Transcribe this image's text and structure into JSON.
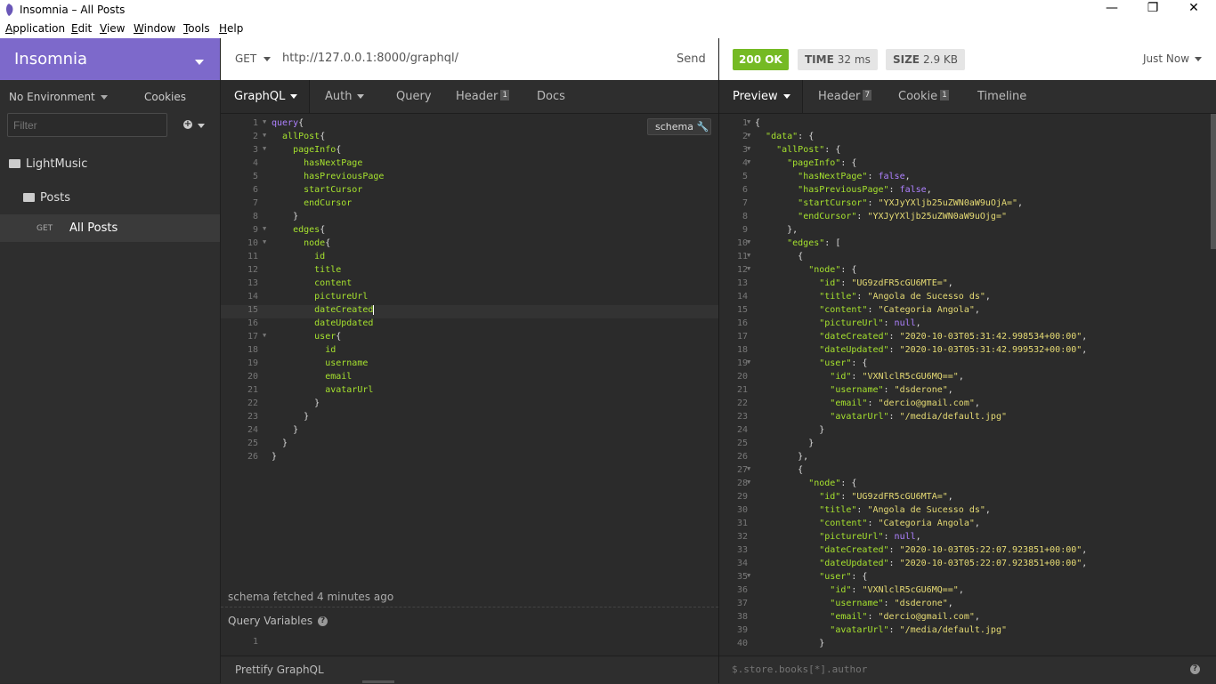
{
  "window": {
    "title": "Insomnia – All Posts",
    "controls": {
      "minimize": "—",
      "maximize": "❐",
      "close": "✕"
    }
  },
  "menu": [
    {
      "pre": "",
      "u": "A",
      "post": "pplication"
    },
    {
      "pre": "",
      "u": "E",
      "post": "dit"
    },
    {
      "pre": "",
      "u": "V",
      "post": "iew"
    },
    {
      "pre": "",
      "u": "W",
      "post": "indow"
    },
    {
      "pre": "",
      "u": "T",
      "post": "ools"
    },
    {
      "pre": "",
      "u": "H",
      "post": "elp"
    }
  ],
  "sidebar": {
    "brand": "Insomnia",
    "brand_color": "#7d69cb",
    "environment": "No Environment",
    "cookies": "Cookies",
    "filter_placeholder": "Filter",
    "workspace": "LightMusic",
    "folder": "Posts",
    "request": {
      "method": "GET",
      "name": "All Posts"
    }
  },
  "request": {
    "method": "GET",
    "url": "http://127.0.0.1:8000/graphql/",
    "send_label": "Send",
    "tabs": [
      {
        "label": "GraphQL",
        "badge": ""
      },
      {
        "label": "Auth",
        "badge": ""
      },
      {
        "label": "Query",
        "badge": ""
      },
      {
        "label": "Header",
        "badge": "1"
      },
      {
        "label": "Docs",
        "badge": ""
      }
    ],
    "schema_button": "schema",
    "schema_status": "schema fetched 4 minutes ago",
    "query_variables_label": "Query Variables",
    "query_variables_line": "1",
    "footer_label": "Prettify GraphQL",
    "query_lines": [
      "query{",
      "  allPost{",
      "    pageInfo{",
      "      hasNextPage",
      "      hasPreviousPage",
      "      startCursor",
      "      endCursor",
      "    }",
      "    edges{",
      "      node{",
      "        id",
      "        title",
      "        content",
      "        pictureUrl",
      "        dateCreated",
      "        dateUpdated",
      "        user{",
      "          id",
      "          username",
      "          email",
      "          avatarUrl",
      "        }",
      "      }",
      "    }",
      "  }",
      "}"
    ]
  },
  "response": {
    "status": "200 OK",
    "status_color": "#75ba24",
    "time_label": "TIME",
    "time_value": "32 ms",
    "size_label": "SIZE",
    "size_value": "2.9 KB",
    "timestamp": "Just Now",
    "tabs": [
      {
        "label": "Preview",
        "badge": ""
      },
      {
        "label": "Header",
        "badge": "7"
      },
      {
        "label": "Cookie",
        "badge": "1"
      },
      {
        "label": "Timeline",
        "badge": ""
      }
    ],
    "filter_placeholder": "$.store.books[*].author",
    "lines": [
      "{",
      "  \"data\": {",
      "    \"allPost\": {",
      "      \"pageInfo\": {",
      "        \"hasNextPage\": false,",
      "        \"hasPreviousPage\": false,",
      "        \"startCursor\": \"YXJyYXljb25uZWN0aW9uOjA=\",",
      "        \"endCursor\": \"YXJyYXljb25uZWN0aW9uOjg=\"",
      "      },",
      "      \"edges\": [",
      "        {",
      "          \"node\": {",
      "            \"id\": \"UG9zdFR5cGU6MTE=\",",
      "            \"title\": \"Angola de Sucesso ds\",",
      "            \"content\": \"Categoria Angola\",",
      "            \"pictureUrl\": null,",
      "            \"dateCreated\": \"2020-10-03T05:31:42.998534+00:00\",",
      "            \"dateUpdated\": \"2020-10-03T05:31:42.999532+00:00\",",
      "            \"user\": {",
      "              \"id\": \"VXNlclR5cGU6MQ==\",",
      "              \"username\": \"dsderone\",",
      "              \"email\": \"dercio@gmail.com\",",
      "              \"avatarUrl\": \"/media/default.jpg\"",
      "            }",
      "          }",
      "        },",
      "        {",
      "          \"node\": {",
      "            \"id\": \"UG9zdFR5cGU6MTA=\",",
      "            \"title\": \"Angola de Sucesso ds\",",
      "            \"content\": \"Categoria Angola\",",
      "            \"pictureUrl\": null,",
      "            \"dateCreated\": \"2020-10-03T05:22:07.923851+00:00\",",
      "            \"dateUpdated\": \"2020-10-03T05:22:07.923851+00:00\",",
      "            \"user\": {",
      "              \"id\": \"VXNlclR5cGU6MQ==\",",
      "              \"username\": \"dsderone\",",
      "              \"email\": \"dercio@gmail.com\",",
      "              \"avatarUrl\": \"/media/default.jpg\"",
      "            }"
    ]
  }
}
